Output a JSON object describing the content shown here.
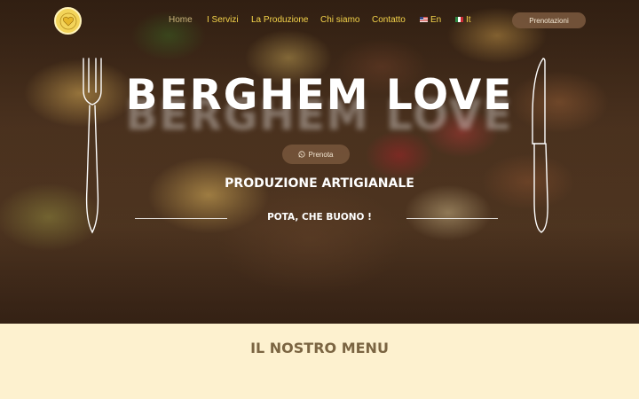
{
  "brand": {
    "logo_icon": "logo-icon"
  },
  "nav": {
    "items": [
      {
        "label": "Home",
        "active": true
      },
      {
        "label": "I Servizi"
      },
      {
        "label": "La Produzione"
      },
      {
        "label": "Chi siamo"
      },
      {
        "label": "Contatto"
      }
    ],
    "languages": [
      {
        "label": "En",
        "flag": "us-flag-icon"
      },
      {
        "label": "It",
        "flag": "italy-flag-icon"
      }
    ],
    "booking_label": "Prenotazioni"
  },
  "hero": {
    "title": "BERGHEM LOVE",
    "cta_label": "Prenota",
    "cta_icon": "whatsapp-icon",
    "subtitle": "PRODUZIONE ARTIGIANALE",
    "tagline": "POTA, CHE BUONO !"
  },
  "menu": {
    "heading": "IL NOSTRO MENU"
  },
  "colors": {
    "nav_text": "#f5d44a",
    "nav_active": "#c9b27a",
    "button_bg": "#76563c",
    "section_bg": "#fdf1cf",
    "heading": "#7b6542"
  }
}
